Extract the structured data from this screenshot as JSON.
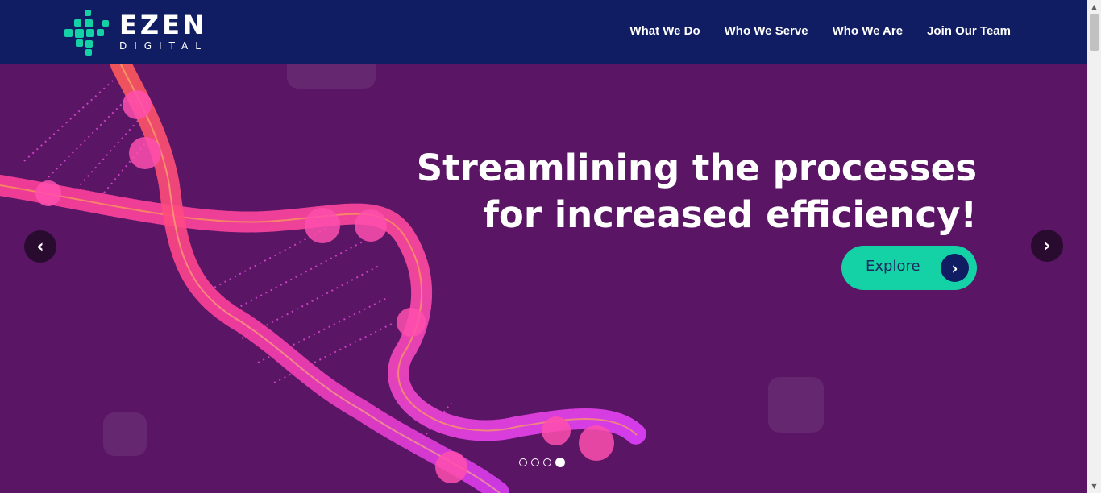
{
  "brand": {
    "name": "EZEN",
    "sub": "DIGITAL",
    "accent": "#14d2a6",
    "nav_bg": "#111d62",
    "hero_bg": "#5a1565"
  },
  "nav": {
    "items": [
      {
        "label": "What We Do"
      },
      {
        "label": "Who We Serve"
      },
      {
        "label": "Who We Are"
      },
      {
        "label": "Join Our Team"
      }
    ]
  },
  "hero": {
    "headline_line1": "Streamlining the processes",
    "headline_line2": "for increased efficiency!",
    "cta_label": "Explore",
    "cta_icon": "chevron-right-icon",
    "prev_icon": "chevron-left-icon",
    "next_icon": "chevron-right-icon",
    "slides": {
      "count": 4,
      "active": 4
    }
  }
}
